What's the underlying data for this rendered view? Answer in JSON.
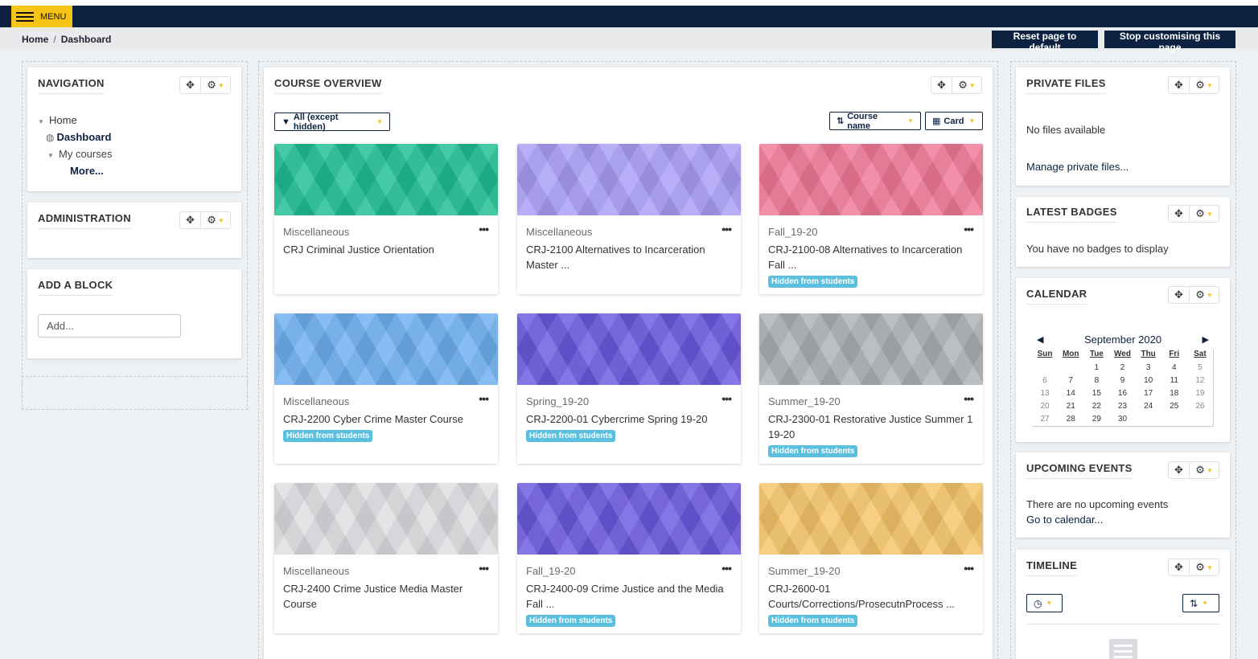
{
  "topbar": {
    "menu_label": "MENU"
  },
  "breadcrumb": {
    "home": "Home",
    "separator": "/",
    "current": "Dashboard"
  },
  "buttons": {
    "reset": "Reset page to default",
    "stop": "Stop customising this page"
  },
  "navigation": {
    "title": "NAVIGATION",
    "items": {
      "home": "Home",
      "dashboard": "Dashboard",
      "my_courses": "My courses",
      "more": "More..."
    }
  },
  "administration": {
    "title": "ADMINISTRATION"
  },
  "add_block": {
    "title": "ADD A BLOCK",
    "select_value": "Add..."
  },
  "course_overview": {
    "title": "COURSE OVERVIEW",
    "filter_label": "All (except hidden)",
    "sort_label": "Course name",
    "view_label": "Card",
    "hidden_badge": "Hidden from students",
    "courses": [
      {
        "category": "Miscellaneous",
        "name": "CRJ Criminal Justice Orientation",
        "hidden": false,
        "color": "#1fbf94"
      },
      {
        "category": "Miscellaneous",
        "name": "CRJ-2100 Alternatives to Incarceration Master ...",
        "hidden": false,
        "color": "#a99ef7"
      },
      {
        "category": "Fall_19-20",
        "name": "CRJ-2100-08 Alternatives to Incarceration Fall ...",
        "hidden": true,
        "color": "#f07898"
      },
      {
        "category": "Miscellaneous",
        "name": "CRJ-2200 Cyber Crime Master Course",
        "hidden": true,
        "color": "#6fb0f2"
      },
      {
        "category": "Spring_19-20",
        "name": "CRJ-2200-01 Cybercrime Spring 19-20",
        "hidden": true,
        "color": "#6a5ae0"
      },
      {
        "category": "Summer_19-20",
        "name": "CRJ-2300-01 Restorative Justice Summer 1 19-20",
        "hidden": true,
        "color": "#adb1b6"
      },
      {
        "category": "Miscellaneous",
        "name": "CRJ-2400 Crime Justice Media Master Course",
        "hidden": false,
        "color": "#dcdee1"
      },
      {
        "category": "Fall_19-20",
        "name": "CRJ-2400-09 Crime Justice and the Media Fall ...",
        "hidden": true,
        "color": "#6b5ae0"
      },
      {
        "category": "Summer_19-20",
        "name": "CRJ-2600-01 Courts/Corrections/ProsecutnProcess ...",
        "hidden": true,
        "color": "#f6c56a"
      }
    ]
  },
  "private_files": {
    "title": "PRIVATE FILES",
    "empty": "No files available",
    "manage": "Manage private files..."
  },
  "latest_badges": {
    "title": "LATEST BADGES",
    "empty": "You have no badges to display"
  },
  "calendar": {
    "title": "CALENDAR",
    "month": "September 2020",
    "days": [
      "Sun",
      "Mon",
      "Tue",
      "Wed",
      "Thu",
      "Fri",
      "Sat"
    ],
    "weeks": [
      [
        "",
        "",
        "1",
        "2",
        "3",
        "4",
        "5"
      ],
      [
        "6",
        "7",
        "8",
        "9",
        "10",
        "11",
        "12"
      ],
      [
        "13",
        "14",
        "15",
        "16",
        "17",
        "18",
        "19"
      ],
      [
        "20",
        "21",
        "22",
        "23",
        "24",
        "25",
        "26"
      ],
      [
        "27",
        "28",
        "29",
        "30",
        "",
        "",
        ""
      ]
    ]
  },
  "upcoming_events": {
    "title": "UPCOMING EVENTS",
    "empty": "There are no upcoming events",
    "link": "Go to calendar..."
  },
  "timeline": {
    "title": "TIMELINE"
  }
}
